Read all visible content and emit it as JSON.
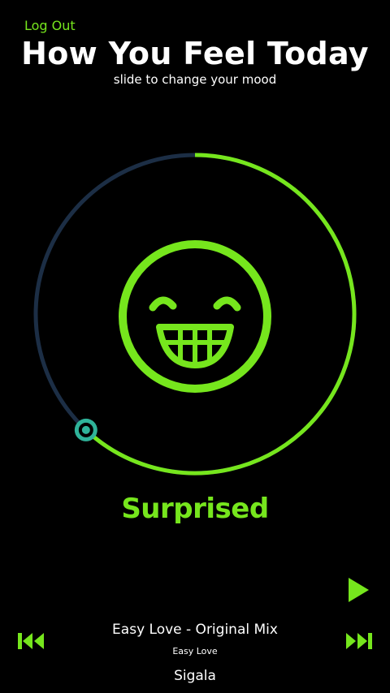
{
  "header": {
    "logout_label": "Log Out",
    "title": "How You Feel Today",
    "subtitle": "slide to change your mood"
  },
  "mood": {
    "label": "Surprised",
    "slider_fraction": 0.62,
    "face_icon": "grinning-face-icon"
  },
  "player": {
    "track_title": "Easy Love - Original Mix",
    "album": "Easy Love",
    "artist": "Sigala",
    "icons": {
      "play": "play-icon",
      "previous": "skip-previous-icon",
      "next": "skip-next-icon"
    }
  },
  "colors": {
    "accent": "#76e61d",
    "track": "#1c2e45",
    "knob": "#2fb39a",
    "background": "#000000"
  }
}
